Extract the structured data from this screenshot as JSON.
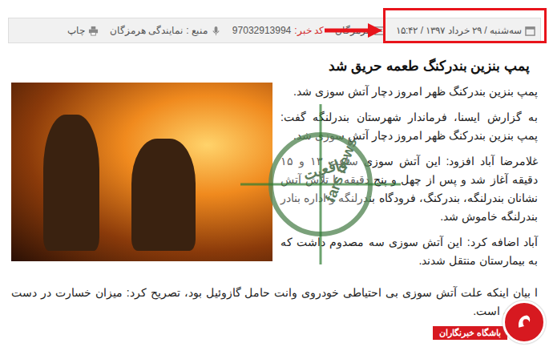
{
  "meta_bar": {
    "date": "سه‌شنبه / ۲۹ خرداد ۱۳۹۷ / ۱۵:۴۲",
    "items": [
      {
        "kind": "category",
        "label": "",
        "value": "هرمزگان"
      },
      {
        "kind": "code",
        "label": "کد خبر:",
        "value": "97032913994"
      },
      {
        "kind": "source",
        "label": "منبع :",
        "value": "نمایندگی هرمزگان"
      },
      {
        "kind": "print",
        "label": "",
        "value": "چاپ"
      }
    ]
  },
  "article": {
    "title": "پمپ بنزین بندرکنگ طعمه حریق شد",
    "side_paragraphs": [
      "پمپ بنزین بندرکنگ ظهر امروز دچار آتش سوزی شد.",
      "به گزارش ایسنا، فرماندار شهرستان بندرلنگه گفت: پمپ بنزین بندرکنگ ظهر امروز دچار آتش سوزی شد.",
      "غلامرضا آباد افزود: این آتش سوزی ساعت ۱۳ و ۱۵ دقیقه آغاز شد و پس از چهل و پنج دقیقه با تلاش آتش نشانان بندرلنگه، بندرکنگ، فرودگاه بندرلنگه و اداره بنادر بندرلنگه خاموش شد.",
      "آباد اضافه کرد: این آتش سوزی سه مصدوم داشت که به بیمارستان منتقل شدند."
    ],
    "full_paragraphs": [
      "ا بیان اینکه علت آتش سوزی بی احتیاطی خودروی وانت حامل گازوئیل بود، تصریح کرد: میزان خسارت در دست بررسی است."
    ]
  },
  "watermark": {
    "top": "واقعیت",
    "bottom": "fars news"
  },
  "logo": {
    "label": "باشگاه خبرنگاران"
  }
}
